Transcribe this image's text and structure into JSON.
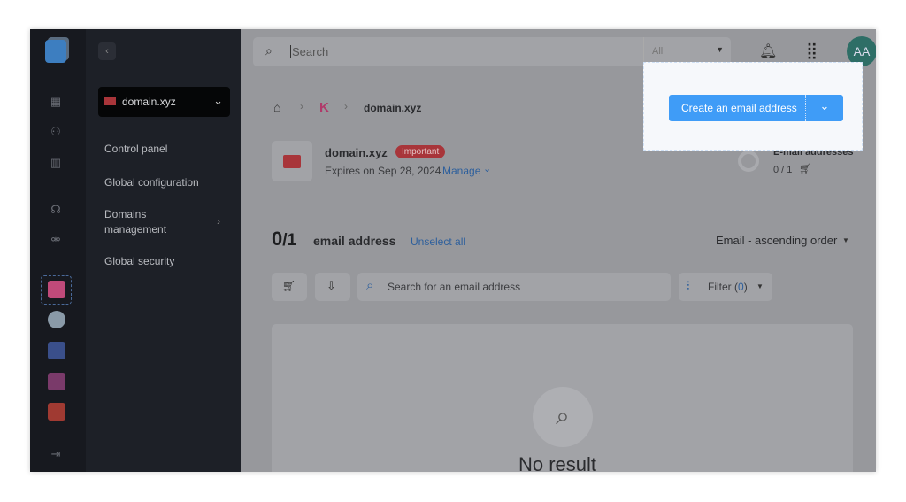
{
  "topbar": {
    "search_placeholder": "Search",
    "scope_select": "All",
    "avatar_initials": "AA"
  },
  "nav": {
    "domain_selector": "domain.xyz",
    "items": [
      {
        "label": "Control panel"
      },
      {
        "label": "Global configuration"
      },
      {
        "label": "Domains management"
      },
      {
        "label": "Global security"
      }
    ]
  },
  "breadcrumb": {
    "current": "domain.xyz"
  },
  "domain_card": {
    "name": "domain.xyz",
    "badge": "Important",
    "expires": "Expires on Sep 28, 2024",
    "manage": "Manage",
    "stat_label": "E-mail addresses",
    "stat_value": "0 / 1"
  },
  "create_button": {
    "label": "Create an email address"
  },
  "list": {
    "count_selected": "0",
    "count_total": "/1",
    "count_label": "email address",
    "unselect_all": "Unselect all",
    "sort": "Email - ascending order",
    "search_placeholder": "Search for an email address",
    "filter_label": "Filter (",
    "filter_count": "0",
    "filter_close": ")"
  },
  "empty": {
    "text": "No result"
  },
  "colors": {
    "accent": "#3f9cf7",
    "badge": "#a8353a",
    "overlay_bg": "#97989c"
  }
}
